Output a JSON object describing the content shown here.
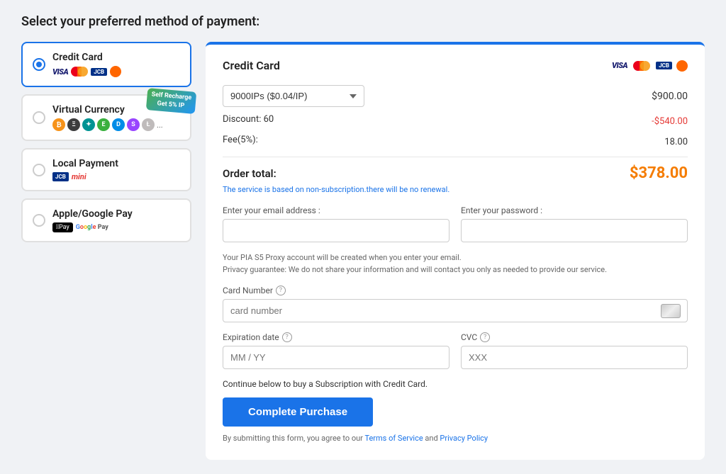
{
  "page": {
    "title": "Select your preferred method of payment:"
  },
  "payment_methods": [
    {
      "id": "credit-card",
      "name": "Credit Card",
      "selected": true,
      "icons": [
        "visa",
        "mastercard",
        "jcb",
        "discover"
      ]
    },
    {
      "id": "virtual-currency",
      "name": "Virtual Currency",
      "selected": false,
      "badge": "Self Recharge\nGet 5% IP",
      "icons": [
        "btc",
        "eth",
        "xrp",
        "etc",
        "dash",
        "sol",
        "ltc",
        "more"
      ]
    },
    {
      "id": "local-payment",
      "name": "Local Payment",
      "selected": false,
      "icons": [
        "jcb",
        "mini"
      ]
    },
    {
      "id": "apple-google-pay",
      "name": "Apple/Google Pay",
      "selected": false,
      "icons": [
        "apple-pay",
        "google-pay"
      ]
    }
  ],
  "panel": {
    "title": "Credit Card",
    "plan_options": [
      {
        "value": "9000IPs ($0.04/IP)",
        "label": "9000IPs ($0.04/IP)"
      }
    ],
    "selected_plan": "9000IPs ($0.04/IP)",
    "base_amount": "$900.00",
    "discount_label": "Discount: 60",
    "discount_amount": "-$540.00",
    "fee_label": "Fee(5%):",
    "fee_amount": "18.00",
    "order_total_label": "Order total:",
    "order_total_amount": "$378.00",
    "no_renewal_note": "The service is based on non-subscription.there will be no renewal.",
    "email_label": "Enter your email address :",
    "email_placeholder": "",
    "password_label": "Enter your password :",
    "password_placeholder": "",
    "privacy_note_1": "Your PIA S5 Proxy account will be created when you enter your email.",
    "privacy_note_2": "Privacy guarantee: We do not share your information and will contact you only as needed to provide our service.",
    "card_number_label": "Card Number",
    "card_number_placeholder": "card number",
    "expiration_label": "Expiration date",
    "expiration_placeholder": "MM / YY",
    "cvc_label": "CVC",
    "cvc_placeholder": "XXX",
    "continue_note": "Continue below to buy a Subscription with Credit Card.",
    "complete_button": "Complete Purchase",
    "terms_prefix": "By submitting this form, you agree to our ",
    "terms_of_service": "Terms of Service",
    "terms_and": " and ",
    "privacy_policy": "Privacy Policy"
  }
}
